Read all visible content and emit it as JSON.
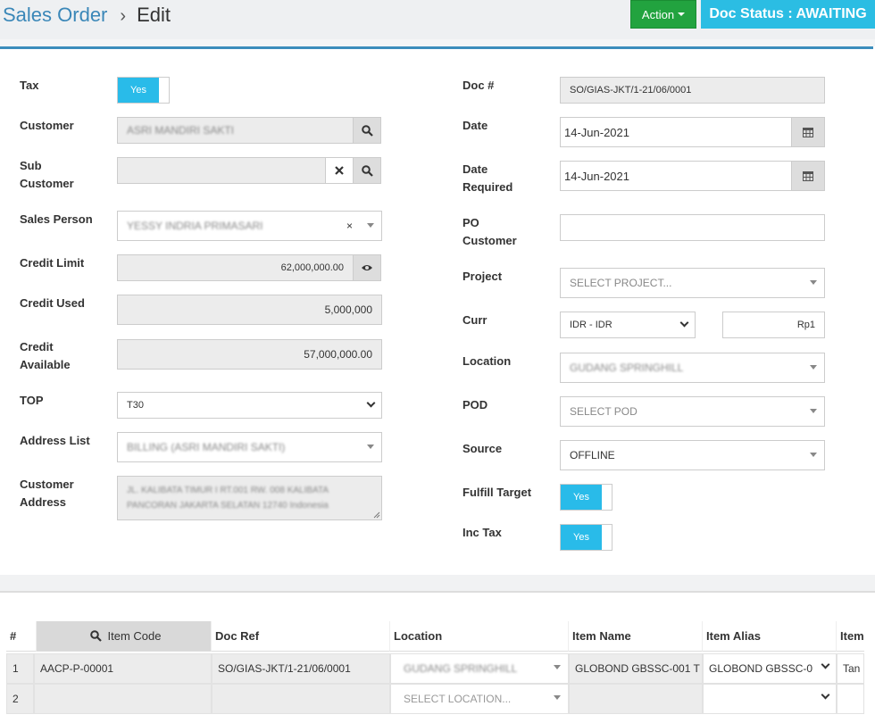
{
  "header": {
    "crumb_root": "Sales Order",
    "crumb_current": "Edit",
    "action_label": "Action",
    "doc_status": "Doc Status : AWAITING"
  },
  "left": {
    "tax_label": "Tax",
    "tax_toggle": "Yes",
    "customer_label": "Customer",
    "customer_value": "ASRI MANDIRI SAKTI",
    "sub_customer_label_1": "Sub",
    "sub_customer_label_2": "Customer",
    "sub_customer_value": "",
    "sales_person_label": "Sales Person",
    "sales_person_value": "YESSY INDRIA PRIMASARI",
    "credit_limit_label": "Credit Limit",
    "credit_limit_value": "62,000,000.00",
    "credit_used_label": "Credit Used",
    "credit_used_value": "5,000,000",
    "credit_available_label_1": "Credit",
    "credit_available_label_2": "Available",
    "credit_available_value": "57,000,000.00",
    "top_label": "TOP",
    "top_value": "T30",
    "address_list_label": "Address List",
    "address_list_value": "BILLING (ASRI MANDIRI SAKTI)",
    "customer_address_label_1": "Customer",
    "customer_address_label_2": "Address",
    "customer_address_line_1": "JL. KALIBATA TIMUR I RT.001 RW. 008 KALIBATA",
    "customer_address_line_2": "PANCORAN JAKARTA SELATAN 12740 Indonesia"
  },
  "right": {
    "doc_label": "Doc #",
    "doc_value": "SO/GIAS-JKT/1-21/06/0001",
    "date_label": "Date",
    "date_value": "14-Jun-2021",
    "date_required_label_1": "Date",
    "date_required_label_2": "Required",
    "date_required_value": "14-Jun-2021",
    "po_customer_label_1": "PO",
    "po_customer_label_2": "Customer",
    "po_customer_value": "",
    "project_label": "Project",
    "project_placeholder": "SELECT PROJECT...",
    "curr_label": "Curr",
    "curr_value": "IDR - IDR",
    "curr_rate": "Rp1",
    "location_label": "Location",
    "location_value": "GUDANG SPRINGHILL",
    "pod_label": "POD",
    "pod_placeholder": "SELECT POD",
    "source_label": "Source",
    "source_value": "OFFLINE",
    "fulfill_target_label": "Fulfill Target",
    "fulfill_target_toggle": "Yes",
    "inc_tax_label": "Inc Tax",
    "inc_tax_toggle": "Yes"
  },
  "table": {
    "headers": {
      "num": "#",
      "item_code": "Item Code",
      "doc_ref": "Doc Ref",
      "location": "Location",
      "item_name": "Item Name",
      "item_alias": "Item Alias",
      "item_extra": "Item"
    },
    "rows": [
      {
        "num": "1",
        "item_code": "AACP-P-00001",
        "doc_ref": "SO/GIAS-JKT/1-21/06/0001",
        "location": "GUDANG SPRINGHILL",
        "item_name": "GLOBOND GBSSC-001 T",
        "item_alias": "GLOBOND GBSSC-0",
        "item_extra": "Tan"
      },
      {
        "num": "2",
        "item_code": "",
        "doc_ref": "",
        "location": "SELECT LOCATION...",
        "item_name": "",
        "item_alias": "",
        "item_extra": ""
      }
    ]
  }
}
